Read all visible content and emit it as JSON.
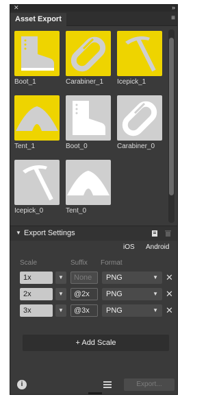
{
  "window": {
    "close_glyph": "✕",
    "collapse_glyph": "»"
  },
  "tab": {
    "title": "Asset Export",
    "menu_glyph": "≡"
  },
  "assets": [
    {
      "label": "Boot_1",
      "icon": "boot-icon",
      "style": "yellow"
    },
    {
      "label": "Carabiner_1",
      "icon": "carabiner-icon",
      "style": "yellow"
    },
    {
      "label": "Icepick_1",
      "icon": "icepick-icon",
      "style": "yellow"
    },
    {
      "label": "Tent_1",
      "icon": "tent-icon",
      "style": "yellow"
    },
    {
      "label": "Boot_0",
      "icon": "boot-icon",
      "style": "grey"
    },
    {
      "label": "Carabiner_0",
      "icon": "carabiner-icon",
      "style": "grey"
    },
    {
      "label": "Icepick_0",
      "icon": "icepick-icon",
      "style": "grey"
    },
    {
      "label": "Tent_0",
      "icon": "tent-icon",
      "style": "grey"
    }
  ],
  "colors": {
    "yellow_tile": "#eed400",
    "grey_tile": "#cfcfcf",
    "panel_bg": "#3a3a3a"
  },
  "export_settings": {
    "title": "Export Settings",
    "platforms": {
      "ios": "iOS",
      "android": "Android"
    },
    "columns": {
      "scale": "Scale",
      "suffix": "Suffix",
      "format": "Format"
    },
    "rows": [
      {
        "scale": "1x",
        "suffix": "None",
        "suffix_is_placeholder": true,
        "format": "PNG"
      },
      {
        "scale": "2x",
        "suffix": "@2x",
        "suffix_is_placeholder": false,
        "format": "PNG"
      },
      {
        "scale": "3x",
        "suffix": "@3x",
        "suffix_is_placeholder": false,
        "format": "PNG"
      }
    ],
    "add_scale_label": "+ Add Scale"
  },
  "footer": {
    "info_glyph": "i",
    "export_label": "Export..."
  }
}
